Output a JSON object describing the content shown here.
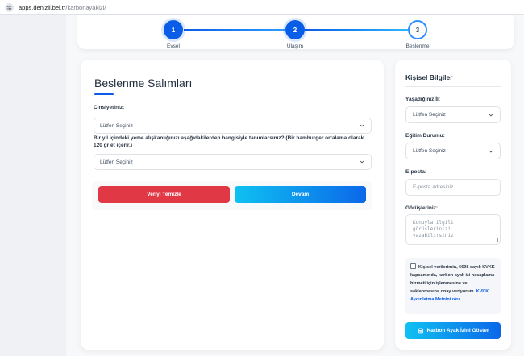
{
  "browser": {
    "url_host": "apps.denizli.bel.tr",
    "url_path": "/karbonayakizi/"
  },
  "stepper": {
    "steps": [
      {
        "number": "1",
        "label": "Evsel",
        "state": "completed"
      },
      {
        "number": "2",
        "label": "Ulaşım",
        "state": "completed"
      },
      {
        "number": "3",
        "label": "Beslenme",
        "state": "current"
      }
    ]
  },
  "main": {
    "title": "Beslenme Salımları",
    "gender_label": "Cinsiyetiniz:",
    "gender_select_value": "Lütfen Seçiniz",
    "diet_question": "Bir yıl içindeki yeme alışkanlığınızı aşağıdakilerden hangisiyle tanımlarsınız? (Bir hamburger ortalama olarak 120 gr et içerir.)",
    "diet_select_value": "Lütfen Seçiniz",
    "clear_button": "Veriyi Temizle",
    "continue_button": "Devam"
  },
  "sidebar": {
    "title": "Kişisel Bilgiler",
    "city_label": "Yaşadığınız İl:",
    "city_select_value": "Lütfen Seçiniz",
    "education_label": "Eğitim Durumu:",
    "education_select_value": "Lütfen Seçiniz",
    "email_label": "E-posta:",
    "email_placeholder": "E-posta adresiniz",
    "opinion_label": "Görüşleriniz:",
    "opinion_placeholder": "Konuyla ilgili görüşlerinizi yazabilirsiniz",
    "consent_text": "Kişisel verilerimin, 6698 sayılı KVKK kapsamında, karbon ayak izi hesaplama hizmeti için işlenmesine ve saklanmasına onay veriyorum.",
    "consent_link": "KVKK Aydınlatma Metnini oku",
    "consent_checked": false,
    "submit_button": "Karbon Ayak İzini Göster"
  },
  "colors": {
    "primary": "#0a5de6",
    "danger": "#e03844",
    "gradient_start": "#0fc1f1",
    "gradient_end": "#0b67e9"
  }
}
